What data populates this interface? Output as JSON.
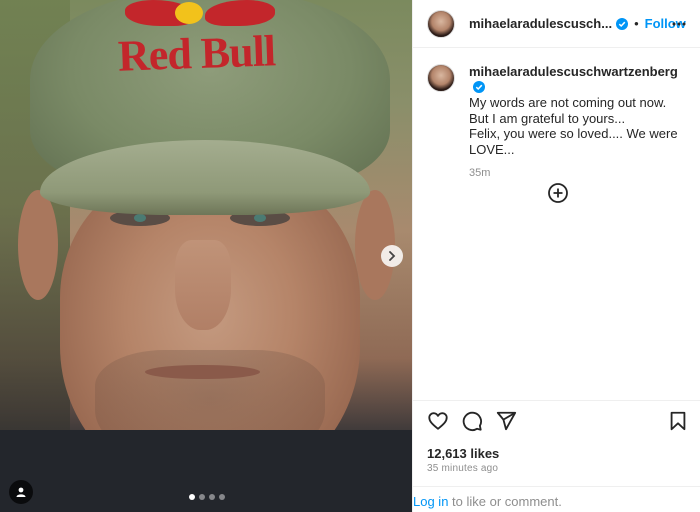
{
  "post": {
    "image_alt": "Portrait photo of a man wearing a green Red Bull cap",
    "cap_logo_text": "Red Bull",
    "carousel_total": 4,
    "carousel_index": 1
  },
  "header": {
    "username": "mihaelaradulescusch...",
    "separator": "•",
    "follow_label": "Follow"
  },
  "caption": {
    "username": "mihaelaradulescuschwartzenberg",
    "lines": [
      "My words are not coming out now.",
      "But I am grateful to yours...",
      "Felix, you were so loved.... We were",
      "LOVE..."
    ],
    "time": "35m"
  },
  "stats": {
    "likes": "12,613 likes",
    "posted_ago": "35 minutes ago"
  },
  "footer": {
    "login_label": "Log in",
    "rest": " to like or comment."
  },
  "colors": {
    "accent": "#0095f6",
    "verified": "#0095f6",
    "muted": "#8e8e8e",
    "text": "#262626"
  },
  "icons": {
    "verified": "verified-badge-icon",
    "more": "more-options-icon",
    "next": "chevron-right-icon",
    "user_tag": "user-tag-icon",
    "load_more": "add-circle-icon",
    "like": "heart-icon",
    "comment": "comment-icon",
    "share": "paper-plane-icon",
    "save": "bookmark-icon"
  }
}
